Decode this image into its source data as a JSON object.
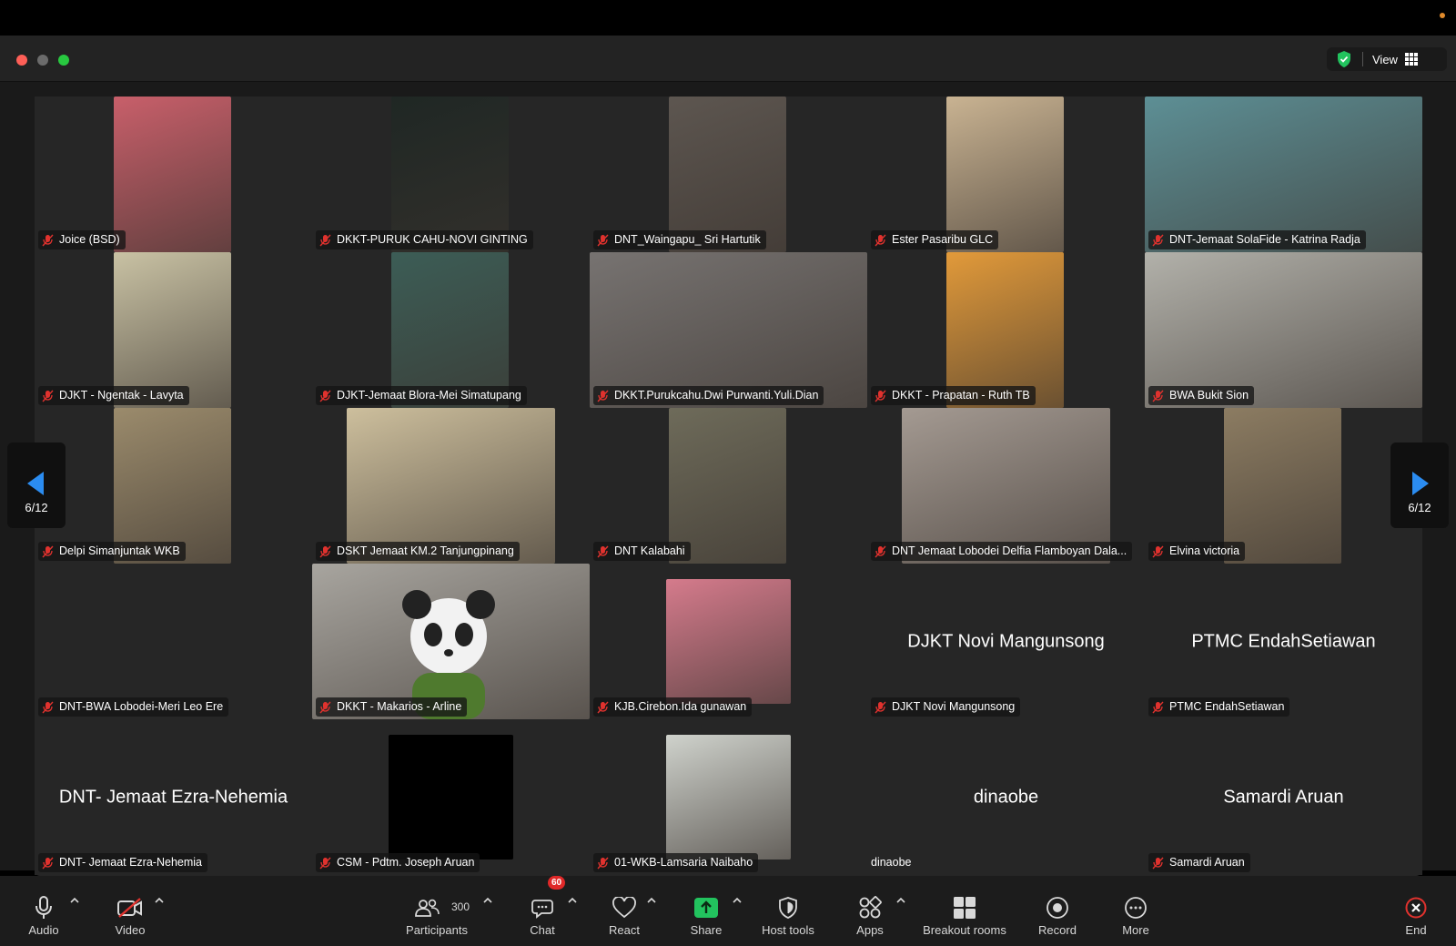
{
  "window": {
    "view_label": "View"
  },
  "pagination": {
    "left_label": "6/12",
    "right_label": "6/12"
  },
  "participants": [
    {
      "name": "Joice (BSD)",
      "bg": "#c85f6a"
    },
    {
      "name": "DKKT-PURUK CAHU-NOVI GINTING",
      "bg": "#1f2724"
    },
    {
      "name": "DNT_Waingapu_ Sri Hartutik",
      "bg": "#5d5650"
    },
    {
      "name": "Ester Pasaribu GLC",
      "bg": "#c9b392"
    },
    {
      "name": "DNT-Jemaat SolaFide - Katrina Radja",
      "bg": "#5d8f95"
    },
    {
      "name": "DJKT - Ngentak - Lavyta",
      "bg": "#c9c2a4"
    },
    {
      "name": "DJKT-Jemaat Blora-Mei Simatupang",
      "bg": "#3c5d56"
    },
    {
      "name": "DKKT.Purukcahu.Dwi Purwanti.Yuli.Dian",
      "bg": "#777371"
    },
    {
      "name": "DKKT - Prapatan - Ruth TB",
      "bg": "#e29a3a"
    },
    {
      "name": "BWA Bukit Sion",
      "bg": "#b2b1aa"
    },
    {
      "name": "Delpi Simanjuntak WKB",
      "bg": "#9b8b6c"
    },
    {
      "name": "DSKT Jemaat KM.2 Tanjungpinang",
      "bg": "#cdbf9d"
    },
    {
      "name": "DNT Kalabahi",
      "bg": "#6e6b5a"
    },
    {
      "name": "DNT Jemaat Lobodei Delfia Flamboyan Dala...",
      "bg": "#a49a92"
    },
    {
      "name": "Elvina victoria",
      "bg": "#8c7c62"
    },
    {
      "name": "DNT-BWA Lobodei-Meri Leo Ere",
      "bg": null
    },
    {
      "name": "DKKT - Makarios - Arline",
      "bg": "#a8a59f"
    },
    {
      "name": "KJB.Cirebon.Ida gunawan",
      "bg": "#d57b8c"
    },
    {
      "name": "DJKT Novi Mangunsong",
      "bg": null,
      "display": "DJKT Novi Mangunsong"
    },
    {
      "name": "PTMC EndahSetiawan",
      "bg": null,
      "display": "PTMC EndahSetiawan"
    },
    {
      "name": "DNT- Jemaat Ezra-Nehemia",
      "bg": null,
      "display": "DNT- Jemaat Ezra-Nehemia"
    },
    {
      "name": "CSM - Pdtm. Joseph Aruan",
      "bg": "#000000"
    },
    {
      "name": "01-WKB-Lamsaria Naibaho",
      "bg": "#cfd2cc"
    },
    {
      "name": "dinaobe",
      "bg": null,
      "display": "dinaobe",
      "unmuted": true
    },
    {
      "name": "Samardi Aruan",
      "bg": null,
      "display": "Samardi Aruan"
    }
  ],
  "toolbar": {
    "audio": "Audio",
    "video": "Video",
    "participants": "Participants",
    "participants_count": "300",
    "chat": "Chat",
    "chat_badge": "60",
    "react": "React",
    "share": "Share",
    "host_tools": "Host tools",
    "apps": "Apps",
    "breakout_rooms": "Breakout rooms",
    "record": "Record",
    "more": "More",
    "end": "End"
  },
  "colors": {
    "share_green": "#22c35e",
    "end_red": "#e0322e",
    "mute_red": "#e0322e",
    "badge_red": "#e02828",
    "nav_arrow_blue": "#2b8cf0"
  }
}
